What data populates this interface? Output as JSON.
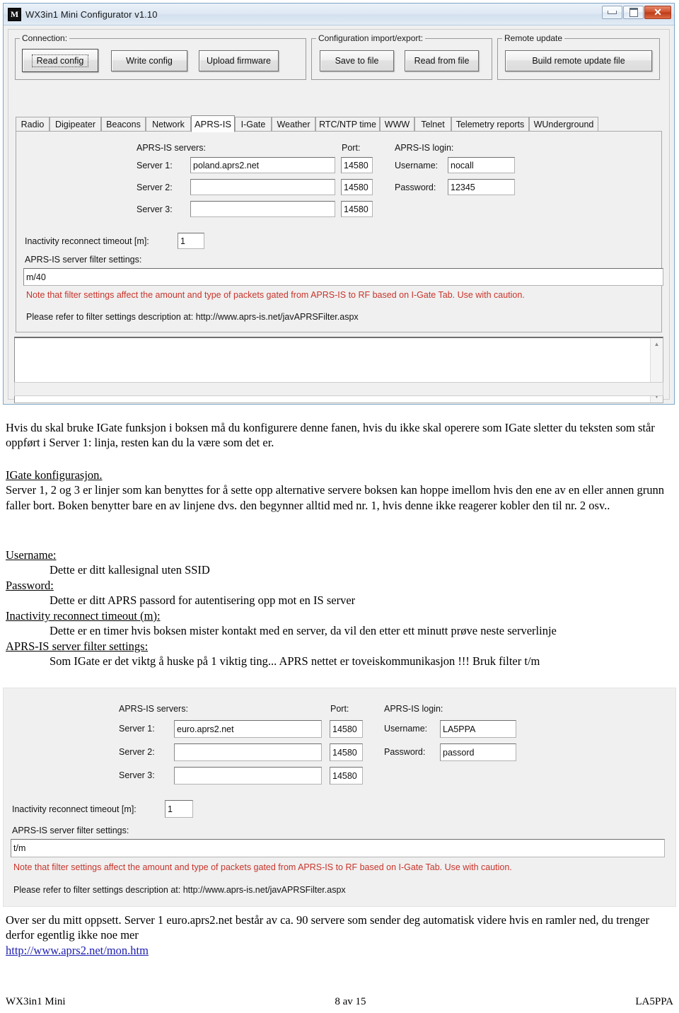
{
  "window": {
    "title": "WX3in1 Mini Configurator v1.10",
    "icon": "app-logo-icon",
    "controls": {
      "minimize": "minimize-icon",
      "maximize": "maximize-icon",
      "close": "✕"
    }
  },
  "toolbar": {
    "connection": {
      "legend": "Connection:",
      "read_config": "Read config",
      "write_config": "Write config",
      "upload_firmware": "Upload firmware"
    },
    "import_export": {
      "legend": "Configuration import/export:",
      "save_to_file": "Save to file",
      "read_from_file": "Read from file"
    },
    "remote_update": {
      "legend": "Remote update",
      "build_remote_update_file": "Build remote update file"
    }
  },
  "tabs": [
    {
      "label": "Radio",
      "active": false
    },
    {
      "label": "Digipeater",
      "active": false
    },
    {
      "label": "Beacons",
      "active": false
    },
    {
      "label": "Network",
      "active": false
    },
    {
      "label": "APRS-IS",
      "active": true
    },
    {
      "label": "I-Gate",
      "active": false
    },
    {
      "label": "Weather",
      "active": false
    },
    {
      "label": "RTC/NTP time",
      "active": false
    },
    {
      "label": "WWW",
      "active": false
    },
    {
      "label": "Telnet",
      "active": false
    },
    {
      "label": "Telemetry reports",
      "active": false
    },
    {
      "label": "WUnderground",
      "active": false
    }
  ],
  "aprsis_panel_1": {
    "servers_header": "APRS-IS servers:",
    "port_header": "Port:",
    "login_header": "APRS-IS login:",
    "server1_label": "Server 1:",
    "server2_label": "Server 2:",
    "server3_label": "Server 3:",
    "server1_value": "poland.aprs2.net",
    "server2_value": "",
    "server3_value": "",
    "port1_value": "14580",
    "port2_value": "14580",
    "port3_value": "14580",
    "username_label": "Username:",
    "username_value": "nocall",
    "password_label": "Password:",
    "password_value": "12345",
    "timeout_label": "Inactivity reconnect timeout [m]:",
    "timeout_value": "1",
    "filter_label": "APRS-IS server filter settings:",
    "filter_value": "m/40",
    "note": "Note that filter settings affect the amount and type of packets gated from APRS-IS to RF based on I-Gate Tab. Use with caution.",
    "refer": "Please refer to filter settings description at: http://www.aprs-is.net/javAPRSFilter.aspx",
    "log_value": ""
  },
  "aprsis_panel_2": {
    "servers_header": "APRS-IS servers:",
    "port_header": "Port:",
    "login_header": "APRS-IS login:",
    "server1_label": "Server 1:",
    "server2_label": "Server 2:",
    "server3_label": "Server 3:",
    "server1_value": "euro.aprs2.net",
    "server2_value": "",
    "server3_value": "",
    "port1_value": "14580",
    "port2_value": "14580",
    "port3_value": "14580",
    "username_label": "Username:",
    "username_value": "LA5PPA",
    "password_label": "Password:",
    "password_value": "passord",
    "timeout_label": "Inactivity reconnect timeout [m]:",
    "timeout_value": "1",
    "filter_label": "APRS-IS server filter settings:",
    "filter_value": "t/m",
    "note": "Note that filter settings affect the amount and type of packets gated from APRS-IS to RF based on I-Gate Tab. Use with caution.",
    "refer": "Please refer to filter settings description at: http://www.aprs-is.net/javAPRSFilter.aspx"
  },
  "document": {
    "intro": "Hvis du skal bruke IGate funksjon i boksen må du konfigurere denne fanen, hvis du ikke skal operere som IGate sletter du teksten som står oppført i Server 1: linja, resten kan du la være som det er.",
    "heading_igate": "IGate konfigurasjon.",
    "igate_body": "Server 1, 2 og 3 er linjer som kan benyttes for å sette opp alternative servere boksen kan hoppe imellom hvis den ene av en eller annen grunn faller bort. Boken benytter bare en av linjene dvs. den begynner alltid med nr. 1, hvis denne ikke reagerer kobler den til nr. 2 osv..",
    "username_heading": "Username:",
    "username_text": "Dette er ditt kallesignal uten SSID",
    "password_heading": "Password:",
    "password_text": "Dette er ditt APRS passord for autentisering opp mot en IS server",
    "timeout_heading": "Inactivity reconnect timeout (m):",
    "timeout_text": "Dette er en timer hvis boksen mister kontakt med en server, da vil den etter ett minutt prøve neste serverlinje",
    "filter_heading": "APRS-IS server filter settings:",
    "filter_text": "Som IGate er det viktg å huske på 1 viktig ting... APRS nettet er toveiskommunikasjon !!!  Bruk filter t/m",
    "closing": "Over ser du mitt oppsett. Server 1 euro.aprs2.net  består av ca. 90 servere som sender deg automatisk videre hvis en ramler ned, du trenger derfor egentlig ikke noe mer",
    "link": "http://www.aprs2.net/mon.htm"
  },
  "footer": {
    "left": "WX3in1 Mini",
    "center": "8 av 15",
    "right": "LA5PPA"
  },
  "colors": {
    "note_red": "#c9342b",
    "link_blue": "#2020b0",
    "window_border": "#7ea7c8"
  }
}
